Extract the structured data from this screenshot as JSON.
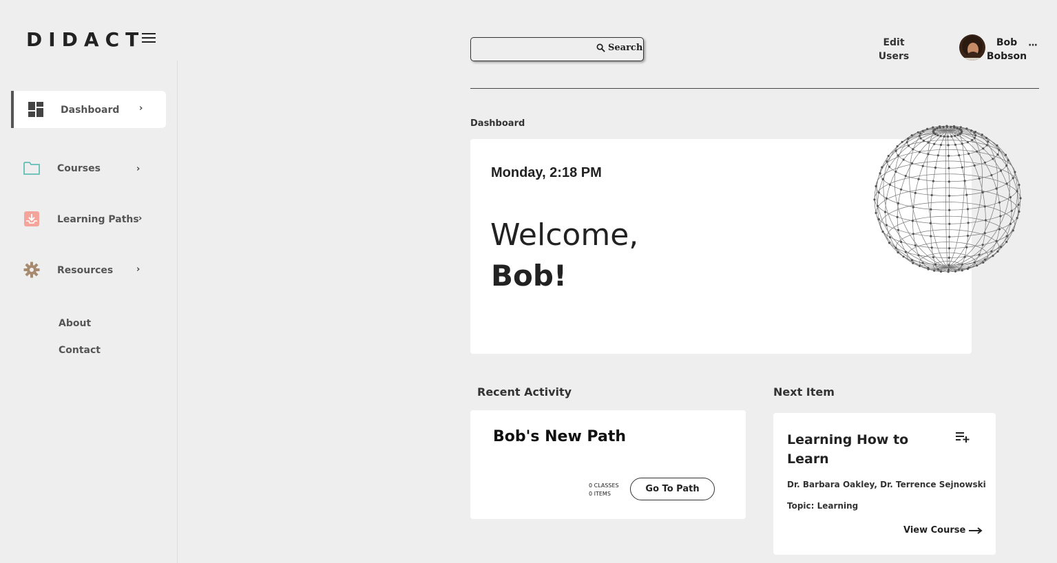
{
  "app": {
    "logo": "DIDACT"
  },
  "sidebar": {
    "items": [
      {
        "label": "Dashboard",
        "icon": "dashboard-icon",
        "active": true
      },
      {
        "label": "Courses",
        "icon": "folder-icon",
        "active": false
      },
      {
        "label": "Learning Paths",
        "icon": "inbox-download-icon",
        "active": false
      },
      {
        "label": "Resources",
        "icon": "gear-icon",
        "active": false
      }
    ],
    "links": [
      {
        "label": "About"
      },
      {
        "label": "Contact"
      }
    ]
  },
  "header": {
    "search": {
      "value": "",
      "placeholder": "",
      "button_label": "Search"
    },
    "edit_users": "Edit Users",
    "user": {
      "first": "Bob",
      "last": "Bobson"
    },
    "more_label": "···"
  },
  "dashboard": {
    "section_label": "Dashboard",
    "datetime": "Monday, 2:18 PM",
    "welcome": "Welcome,",
    "name": "Bob!"
  },
  "recent_activity": {
    "heading": "Recent Activity",
    "path_title": "Bob's New Path",
    "classes": "0 CLASSES",
    "items": "0 ITEMS",
    "button": "Go To Path"
  },
  "next_item": {
    "heading": "Next Item",
    "title": "Learning How to Learn",
    "authors": "Dr. Barbara Oakley, Dr. Terrence Sejnowski",
    "topic": "Topic: Learning",
    "link": "View Course"
  },
  "colors": {
    "background": "#eeeeee",
    "card": "#ffffff",
    "courses_icon": "#5fbfb5",
    "learning_paths_icon": "#f08c82",
    "resources_icon": "#a88a6e",
    "dashboard_icon": "#444444"
  }
}
